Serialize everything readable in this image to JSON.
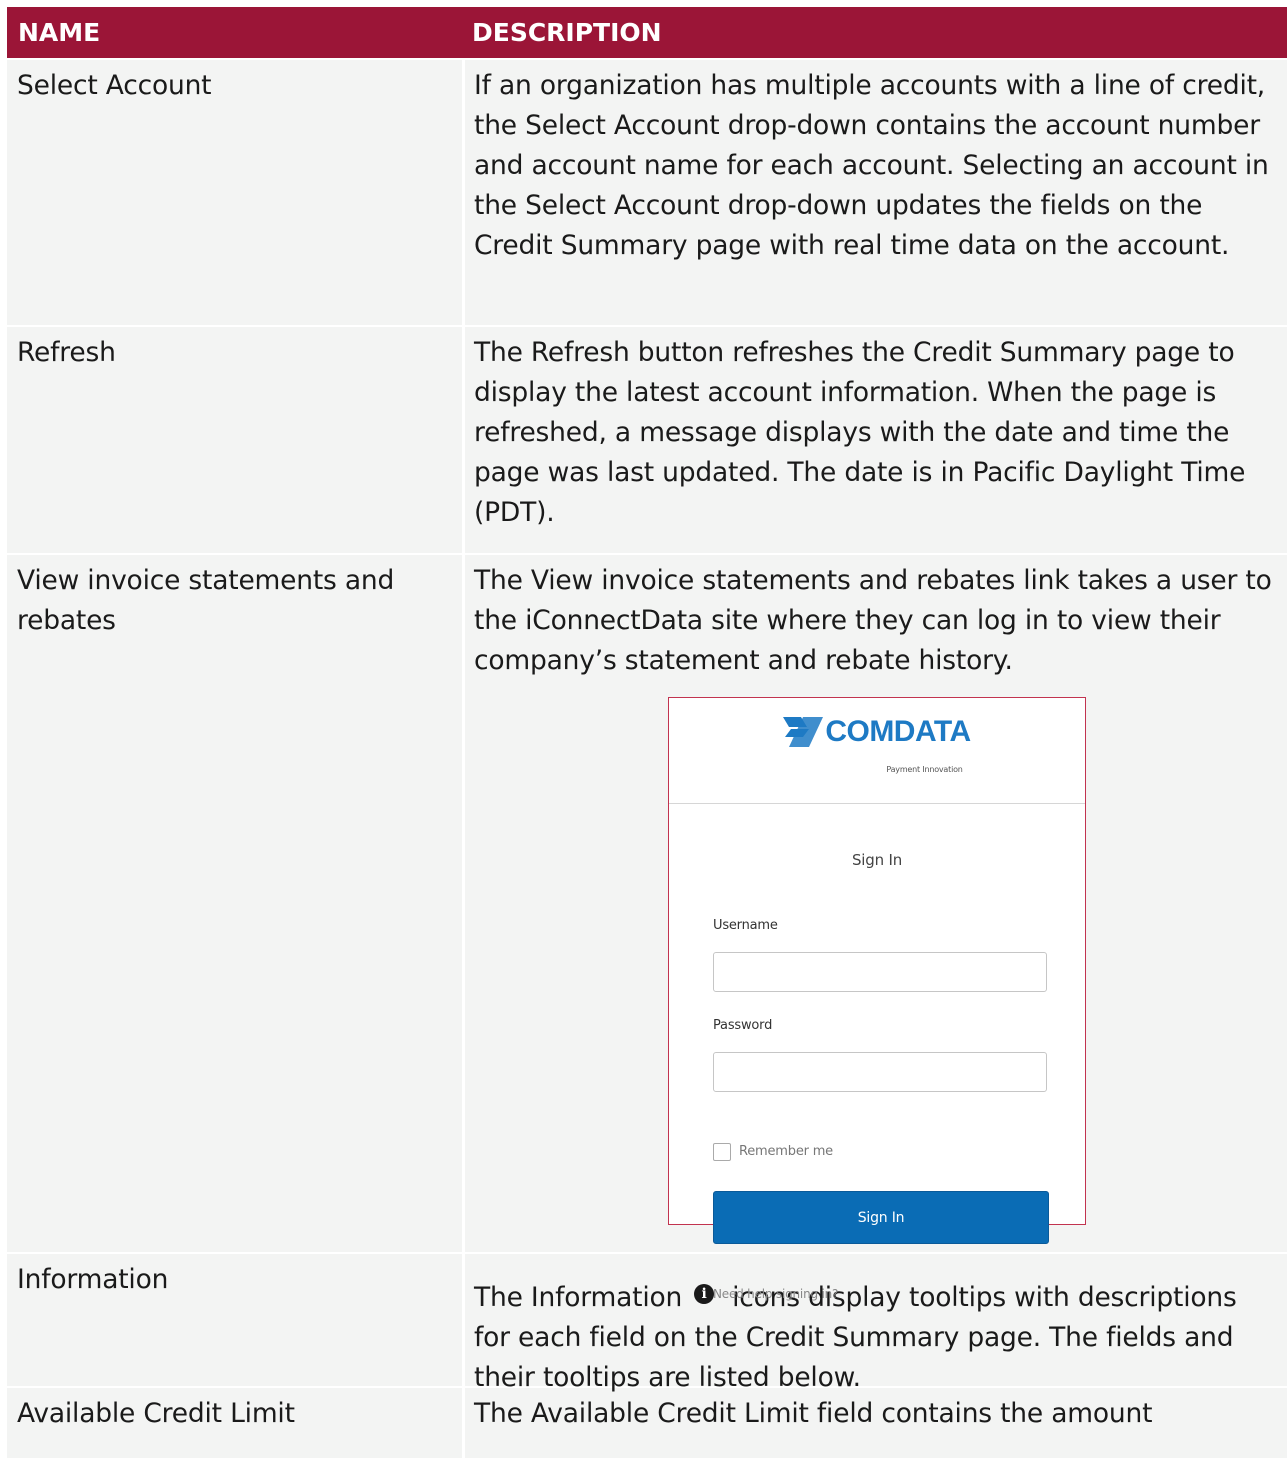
{
  "table": {
    "headers": {
      "name": "NAME",
      "description": "DESCRIPTION"
    },
    "rows": [
      {
        "name": "Select Account",
        "description": "If an organization has multiple accounts with a line of credit, the Select Account drop-down contains the account number and account name for each account. Selecting an account in the Select Account drop-down updates the fields on the Credit Summary page with real time data on the account."
      },
      {
        "name": "Refresh",
        "description": "The Refresh button refreshes the Credit Summary page to display the latest account information. When the page is refreshed, a message displays with the date and time the page was last updated. The date is in Pacific Daylight Time (PDT)."
      },
      {
        "name": "View invoice statements and rebates",
        "description": "The View invoice statements and rebates link takes a user to the iConnectData site where they can log in to view their company’s statement and rebate history."
      },
      {
        "name": "Information",
        "description_before_icon": "The Information",
        "description_after_icon": "icons display tooltips with descriptions for each field on the Credit Summary page. The fields and their tooltips are listed below."
      },
      {
        "name": "Available Credit Limit",
        "description": "The Available Credit Limit field contains the amount"
      }
    ]
  },
  "signin_image": {
    "logo_text": "COMDATA",
    "logo_tagline": "Payment Innovation",
    "title": "Sign In",
    "username_label": "Username",
    "password_label": "Password",
    "remember_label": "Remember me",
    "button_label": "Sign In",
    "help_link": "Need help signing in?"
  },
  "colors": {
    "header_bg": "#9b1537",
    "row_bg": "#f3f4f3",
    "image_border": "#c2334f",
    "button_blue": "#0a6cb5",
    "logo_blue": "#1e7ac4"
  },
  "icons": {
    "information": "info-circle-icon",
    "logo_mark": "comdata-logo-icon"
  }
}
